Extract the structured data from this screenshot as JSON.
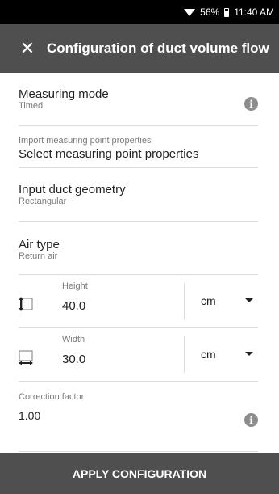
{
  "status_bar": {
    "battery": "56%",
    "time": "11:40 AM"
  },
  "header": {
    "close_icon": "close-icon",
    "title": "Configuration of duct volume flow"
  },
  "measuring_mode": {
    "label": "Measuring mode",
    "value": "Timed"
  },
  "import_props": {
    "label": "Import measuring point properties",
    "value": "Select measuring point properties"
  },
  "duct_geometry": {
    "label": "Input duct geometry",
    "value": "Rectangular"
  },
  "air_type": {
    "label": "Air type",
    "value": "Return air"
  },
  "height": {
    "label": "Height",
    "value": "40.0",
    "unit": "cm"
  },
  "width": {
    "label": "Width",
    "value": "30.0",
    "unit": "cm"
  },
  "correction_factor": {
    "label": "Correction factor",
    "value": "1.00"
  },
  "footer": {
    "apply_label": "APPLY CONFIGURATION"
  },
  "colors": {
    "app_bar": "#4f4f4f",
    "status_bar": "#000000",
    "divider": "#dcdcdc",
    "info_icon": "#8d8d8d"
  }
}
